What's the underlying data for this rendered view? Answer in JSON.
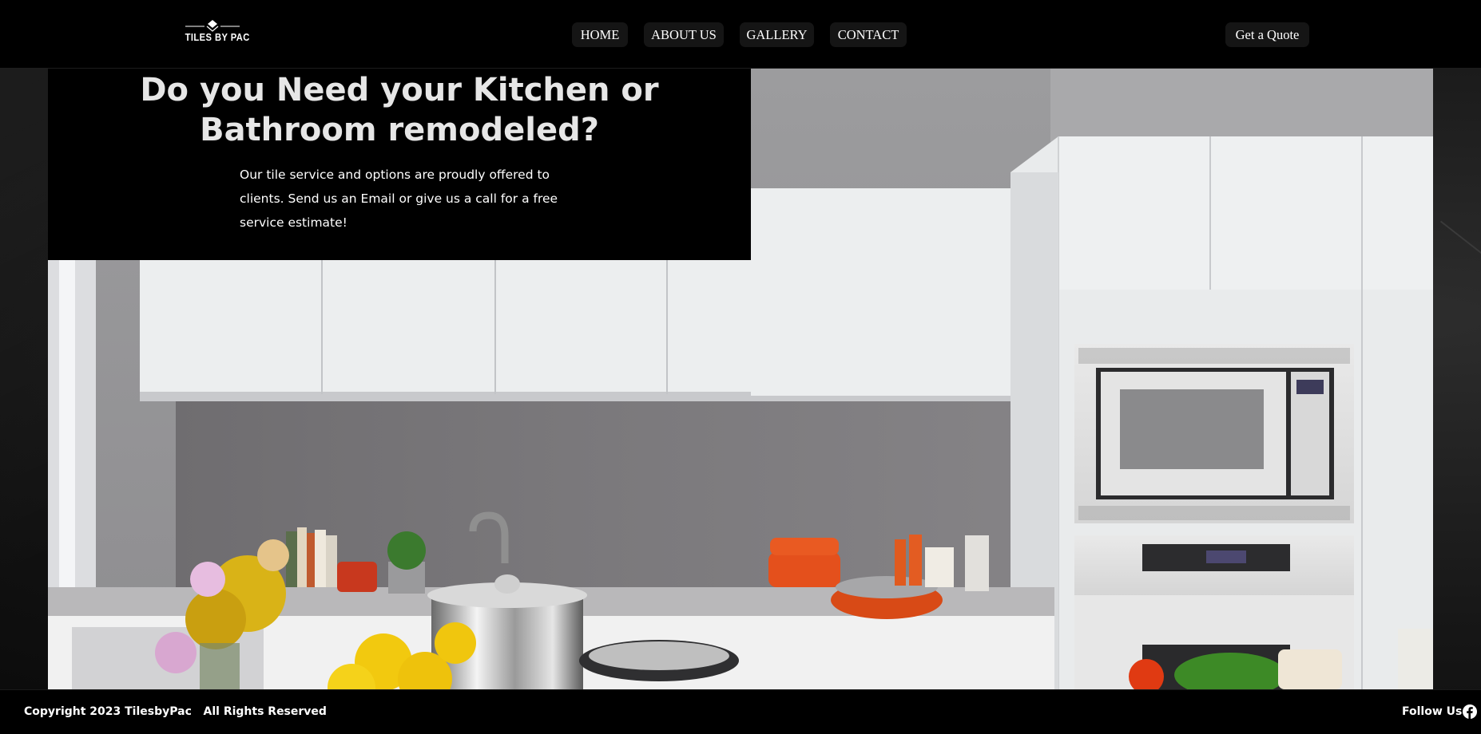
{
  "brand": {
    "logo_text": "TILES BY PAC"
  },
  "nav": {
    "items": [
      {
        "label": "HOME"
      },
      {
        "label": "ABOUT US"
      },
      {
        "label": "GALLERY"
      },
      {
        "label": "CONTACT"
      }
    ],
    "cta_label": "Get a Quote"
  },
  "hero": {
    "title_line1": "Do you Need your Kitchen or",
    "title_line2": "Bathroom remodeled?",
    "body": "Our tile service and options are proudly offered to clients. Send us an Email or give us a call for a free service estimate!"
  },
  "footer": {
    "copyright": "Copyright 2023 TilesbyPac   All Rights Reserved",
    "follow_label": "Follow Us",
    "social_icon": "facebook-icon"
  },
  "colors": {
    "page_background": "#000000",
    "nav_button": "#151515",
    "hero_title": "#e6e6e6",
    "cabinet_white": "#eceeef",
    "backsplash_grey": "#7d7b7d"
  }
}
